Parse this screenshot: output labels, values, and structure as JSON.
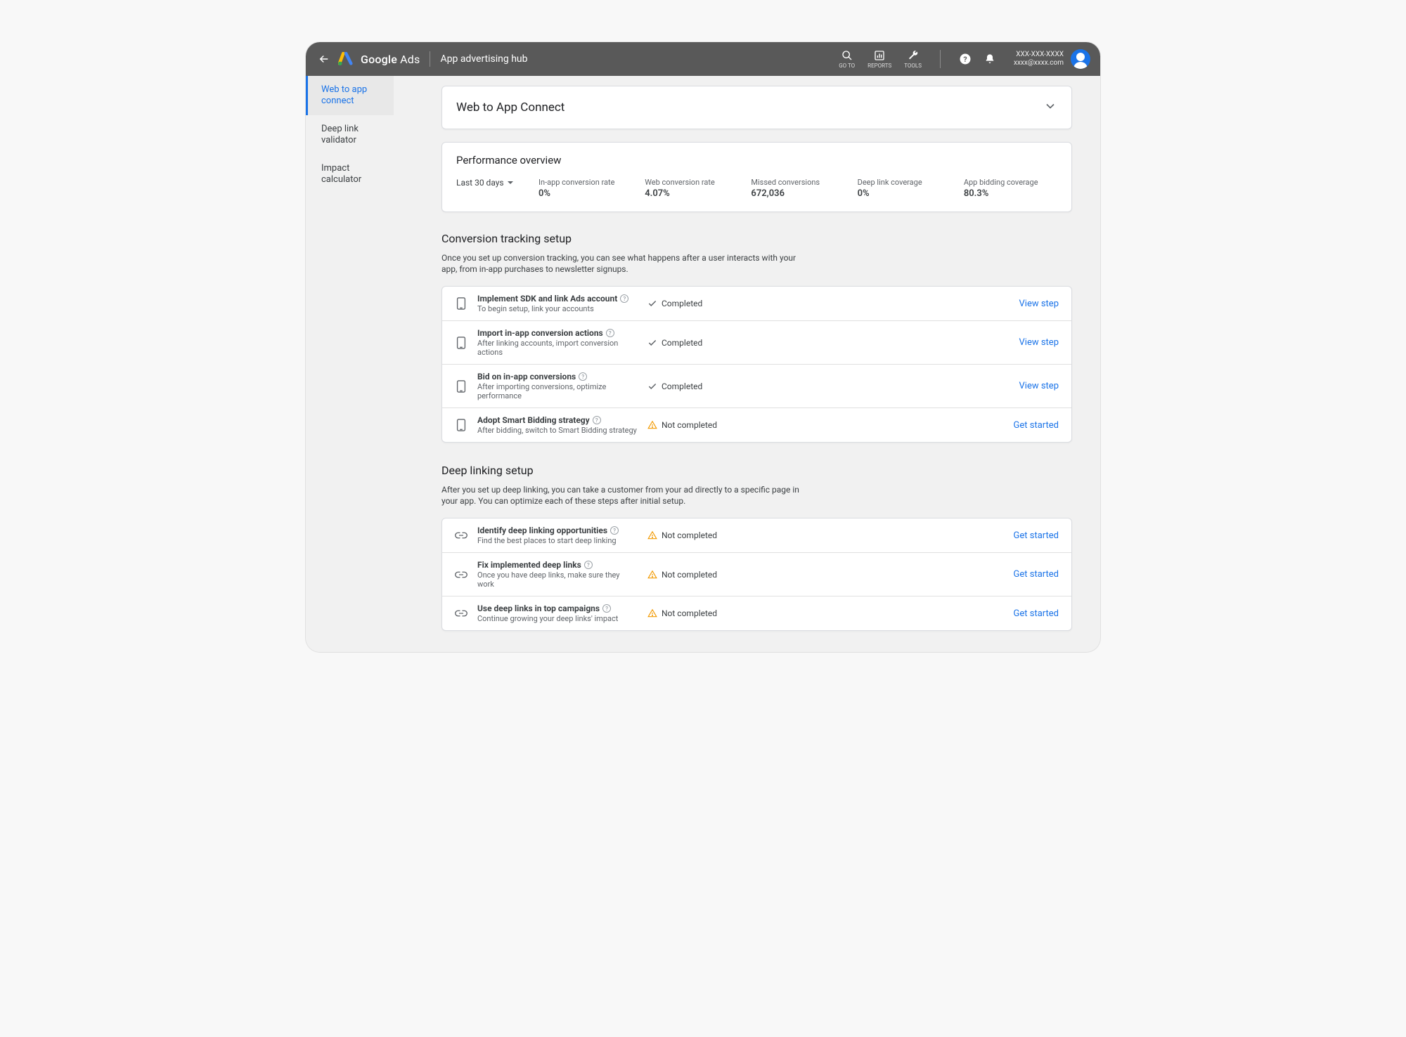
{
  "header": {
    "brand_bold": "Google",
    "brand_rest": " Ads",
    "subtitle": "App advertising hub",
    "icons": {
      "goto": "GO TO",
      "reports": "REPORTS",
      "tools": "TOOLS"
    },
    "account_id": "XXX-XXX-XXXX",
    "account_email": "xxxx@xxxx.com"
  },
  "sidebar": [
    {
      "label": "Web to app connect",
      "active": true
    },
    {
      "label": "Deep link validator",
      "active": false
    },
    {
      "label": "Impact calculator",
      "active": false
    }
  ],
  "hero_title": "Web to App Connect",
  "performance": {
    "title": "Performance overview",
    "range": "Last 30 days",
    "metrics": [
      {
        "label": "In-app conversion rate",
        "value": "0%"
      },
      {
        "label": "Web conversion rate",
        "value": "4.07%"
      },
      {
        "label": "Missed conversions",
        "value": "672,036"
      },
      {
        "label": "Deep link coverage",
        "value": "0%"
      },
      {
        "label": "App bidding coverage",
        "value": "80.3%"
      }
    ]
  },
  "sections": [
    {
      "title": "Conversion tracking setup",
      "desc": "Once you set up conversion tracking, you can see what happens after a user interacts with your app, from in-app purchases to newsletter signups.",
      "icon": "phone",
      "steps": [
        {
          "title": "Implement SDK and link Ads account",
          "sub": "To begin setup, link your accounts",
          "status": "completed",
          "status_text": "Completed",
          "action": "View step"
        },
        {
          "title": "Import in-app conversion actions",
          "sub": "After linking accounts, import conversion actions",
          "status": "completed",
          "status_text": "Completed",
          "action": "View step"
        },
        {
          "title": "Bid on in-app conversions",
          "sub": "After importing conversions, optimize performance",
          "status": "completed",
          "status_text": "Completed",
          "action": "View step"
        },
        {
          "title": "Adopt Smart Bidding strategy",
          "sub": "After bidding, switch to Smart Bidding strategy",
          "status": "not_completed",
          "status_text": "Not completed",
          "action": "Get started"
        }
      ]
    },
    {
      "title": "Deep linking setup",
      "desc": "After you set up deep linking, you can take a customer from your ad directly to a specific page in your app. You can optimize each of these steps after initial setup.",
      "icon": "link",
      "steps": [
        {
          "title": "Identify deep linking opportunities",
          "sub": "Find the best places to start deep linking",
          "status": "not_completed",
          "status_text": "Not completed",
          "action": "Get started"
        },
        {
          "title": "Fix implemented deep links",
          "sub": "Once you have deep links, make sure they work",
          "status": "not_completed",
          "status_text": "Not completed",
          "action": "Get started"
        },
        {
          "title": "Use deep links in top campaigns",
          "sub": "Continue growing your deep links' impact",
          "status": "not_completed",
          "status_text": "Not completed",
          "action": "Get started"
        }
      ]
    }
  ]
}
